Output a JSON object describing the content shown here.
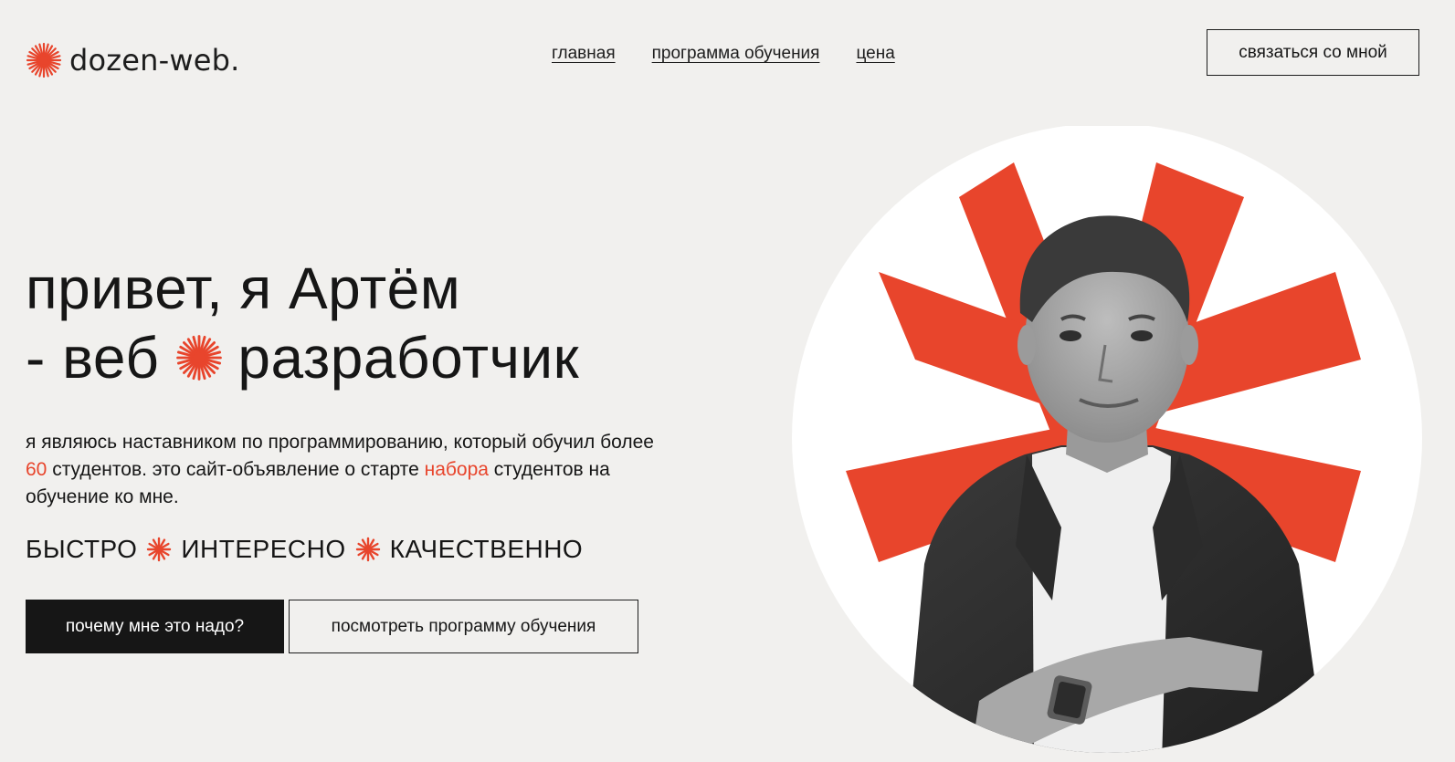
{
  "brand": {
    "name": "dozen-web.",
    "accent_color": "#e8452c"
  },
  "nav": {
    "items": [
      "главная",
      "программа обучения",
      "цена"
    ]
  },
  "header": {
    "contact_label": "связаться со мной"
  },
  "hero": {
    "headline_line1": "привет, я Артём",
    "headline_line2_a": "- веб",
    "headline_line2_b": "разработчик",
    "desc_part1": "я являюсь наставником по программированию, который обучил более ",
    "desc_number": "60",
    "desc_part2": " студентов. это сайт-объявление о старте ",
    "desc_link": "набора",
    "desc_part3": " студентов на обучение ко мне.",
    "tagline": [
      "БЫСТРО",
      "ИНТЕРЕСНО",
      "КАЧЕСТВЕННО"
    ],
    "btn_primary": "почему мне это надо?",
    "btn_secondary": "посмотреть программу обучения"
  },
  "icons": {
    "logo": "sunburst-icon",
    "separator": "asterisk-icon"
  }
}
